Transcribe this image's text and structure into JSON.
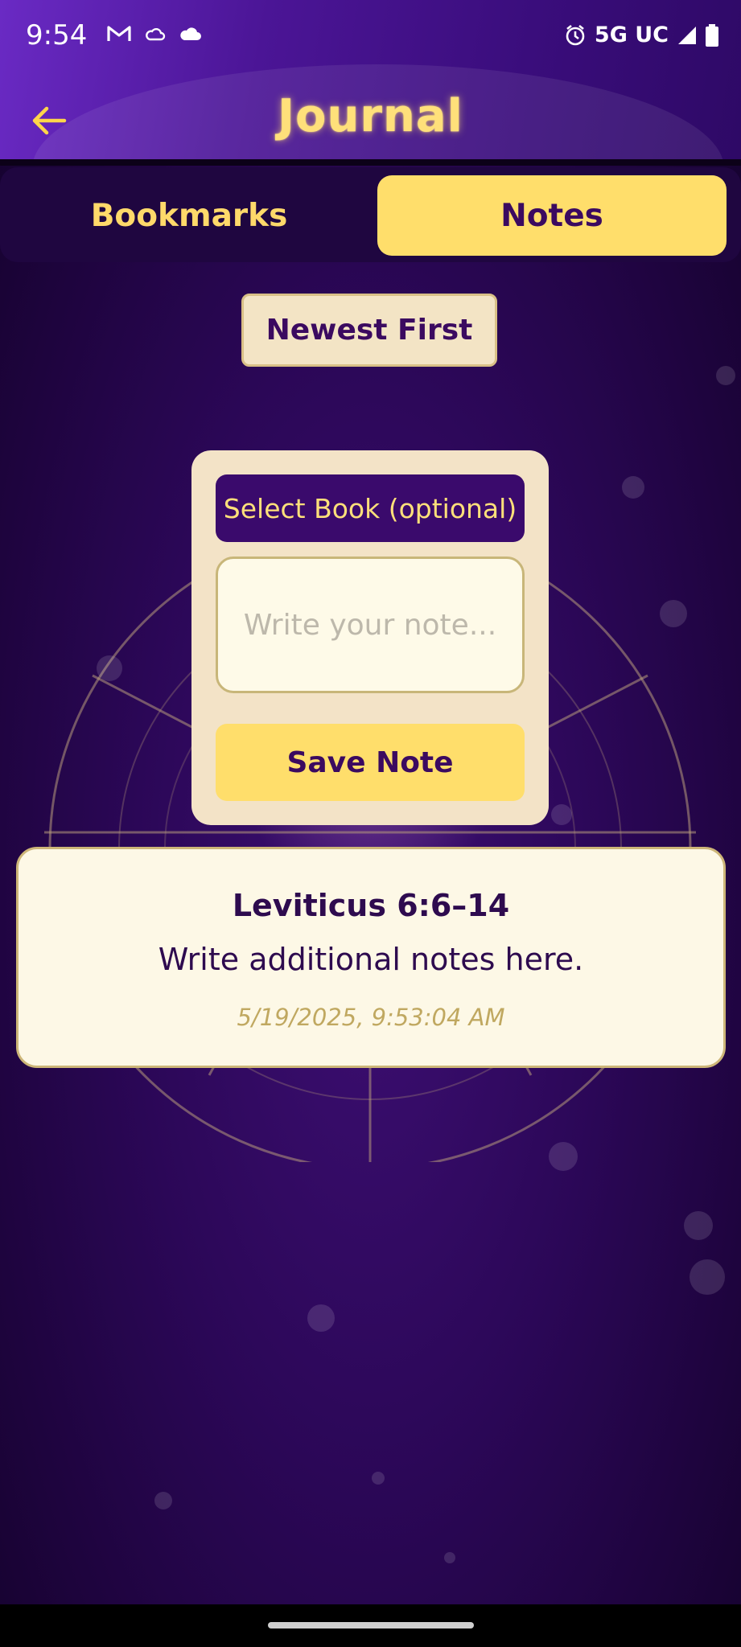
{
  "status_bar": {
    "time": "9:54",
    "network": "5G UC",
    "icons": [
      "gmail-icon",
      "cloud-outline-icon",
      "cloud-icon",
      "alarm-icon",
      "signal-icon",
      "battery-icon"
    ]
  },
  "header": {
    "title": "Journal",
    "back_icon": "arrow-left-icon"
  },
  "tabs": [
    {
      "label": "Bookmarks",
      "selected": false
    },
    {
      "label": "Notes",
      "selected": true
    }
  ],
  "sort": {
    "label": "Newest First"
  },
  "note_form": {
    "book_select": "Select Book (optional)",
    "note_placeholder": "Write your note...",
    "save_label": "Save Note"
  },
  "notes": [
    {
      "reference": "Leviticus 6:6–14",
      "text": "Write additional notes here.",
      "date": "5/19/2025, 9:53:04 AM"
    }
  ],
  "colors": {
    "accent_gold": "#ffde6b",
    "title_gold": "#ffe07a",
    "deep_purple": "#3a0a6c",
    "card_cream": "#fdf8e6"
  }
}
